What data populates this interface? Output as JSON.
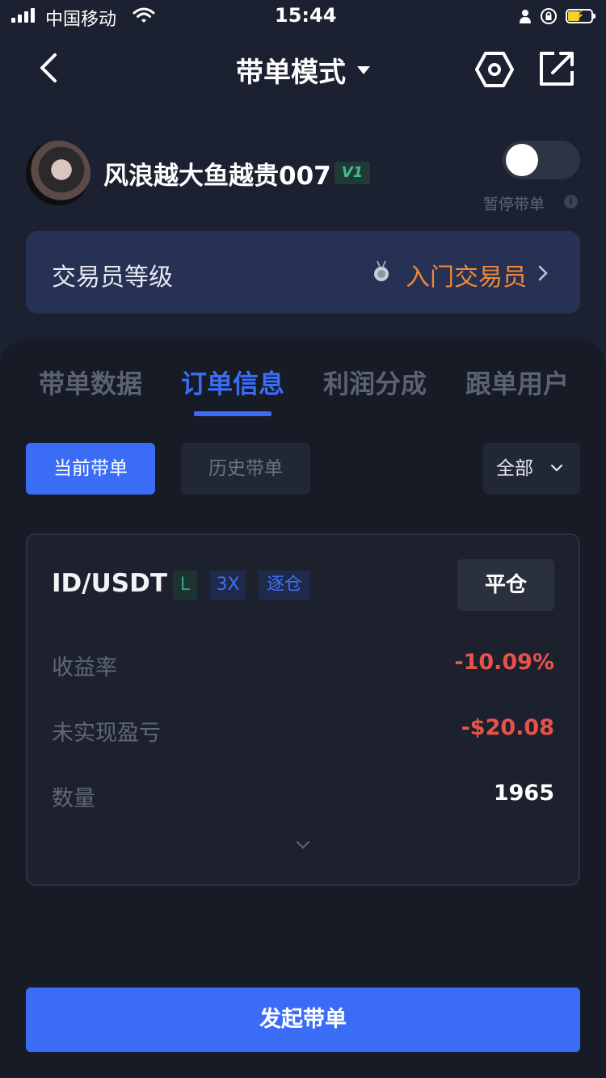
{
  "status_bar": {
    "carrier": "中国移动",
    "time": "15:44"
  },
  "nav": {
    "title": "带单模式",
    "icons": [
      "back-chevron-icon",
      "caret-down-icon",
      "hexagon-settings-icon",
      "share-icon"
    ]
  },
  "profile": {
    "username": "风浪越大鱼越贵007",
    "vip_badge": "V1",
    "pause_label": "暂停带单",
    "pause_toggle_on": false
  },
  "trader_level": {
    "title": "交易员等级",
    "value": "入门交易员",
    "accent_color": "#f0883a"
  },
  "tabs": [
    {
      "label": "带单数据",
      "active": false
    },
    {
      "label": "订单信息",
      "active": true
    },
    {
      "label": "利润分成",
      "active": false
    },
    {
      "label": "跟单用户",
      "active": false
    }
  ],
  "segments": {
    "current": "当前带单",
    "history": "历史带单",
    "selected": "当前带单"
  },
  "filter": {
    "selected": "全部"
  },
  "order": {
    "pair": "ID/USDT",
    "side_tag": "L",
    "leverage_tag": "3X",
    "margin_tag": "逐仓",
    "close_button": "平仓",
    "rows": [
      {
        "label": "收益率",
        "value": "-10.09%"
      },
      {
        "label": "未实现盈亏",
        "value": "-$20.08"
      },
      {
        "label": "数量",
        "value": "1965"
      }
    ]
  },
  "primary_button": "发起带单",
  "colors": {
    "background": "#1b2130",
    "accent": "#3b6cf6",
    "negative": "#e9524a",
    "positive_tag": "#2ea87b"
  }
}
